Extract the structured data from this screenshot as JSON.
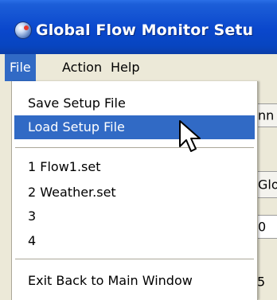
{
  "window": {
    "title": "Global Flow Monitor Setu"
  },
  "menubar": {
    "items": [
      {
        "label": "File"
      },
      {
        "label": "Action"
      },
      {
        "label": "Help"
      }
    ]
  },
  "file_menu": {
    "items": [
      {
        "label": "Save Setup File",
        "highlighted": false
      },
      {
        "label": "Load Setup File",
        "highlighted": true
      },
      {
        "label": "1 Flow1.set",
        "highlighted": false
      },
      {
        "label": "2 Weather.set",
        "highlighted": false
      },
      {
        "label": "3",
        "highlighted": false
      },
      {
        "label": "4",
        "highlighted": false
      },
      {
        "label": "Exit Back to Main Window",
        "highlighted": false
      }
    ]
  },
  "background": {
    "fragments": [
      "nn",
      "Glo",
      "0",
      "5"
    ]
  },
  "colors": {
    "title_bar": "#0a47cc",
    "highlight": "#316ac5",
    "menu_bg": "#ffffff",
    "window_bg": "#ece9d8"
  },
  "icons": {
    "app": "globe-icon",
    "cursor": "arrow-cursor-icon"
  }
}
